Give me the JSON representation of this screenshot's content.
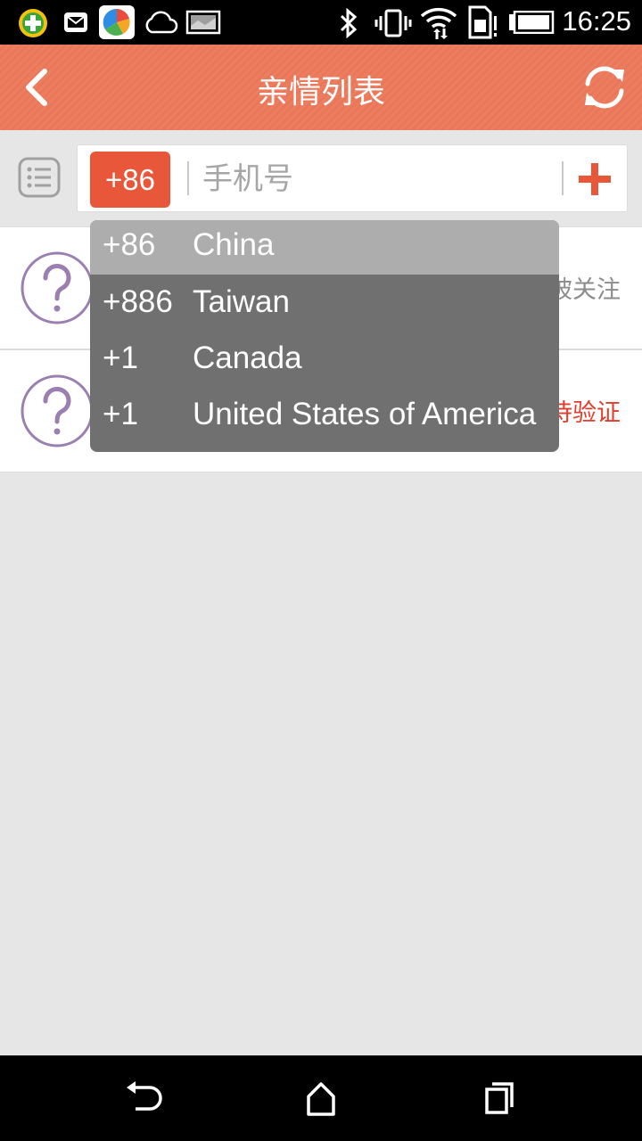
{
  "status_bar": {
    "time": "16:25",
    "icons": [
      "shield-plus-icon",
      "mail-icon",
      "app-store-icon",
      "cloud-icon",
      "image-icon",
      "bluetooth-icon",
      "vibrate-icon",
      "wifi-icon",
      "sim-card-icon",
      "battery-icon"
    ]
  },
  "header": {
    "title": "亲情列表",
    "back_icon": "chevron-left-icon",
    "refresh_icon": "refresh-icon",
    "background_color": "#ec7d5e"
  },
  "search": {
    "country_code": "+86",
    "phone_placeholder": "手机号",
    "phone_value": "",
    "add_icon": "plus-icon",
    "list_icon": "list-icon",
    "accent_color": "#e9573a"
  },
  "contacts": [
    {
      "avatar_icon": "question-mark-icon",
      "status": "被关注"
    },
    {
      "avatar_icon": "question-mark-icon",
      "status": "待验证"
    }
  ],
  "dropdown": {
    "options": [
      {
        "code": "+86",
        "country": "China",
        "selected": true
      },
      {
        "code": "+886",
        "country": "Taiwan",
        "selected": false
      },
      {
        "code": "+1",
        "country": "Canada",
        "selected": false
      },
      {
        "code": "+1",
        "country": "United States of America",
        "selected": false
      }
    ]
  },
  "nav_bar": {
    "icons": [
      "back-icon",
      "home-icon",
      "recent-apps-icon"
    ]
  }
}
